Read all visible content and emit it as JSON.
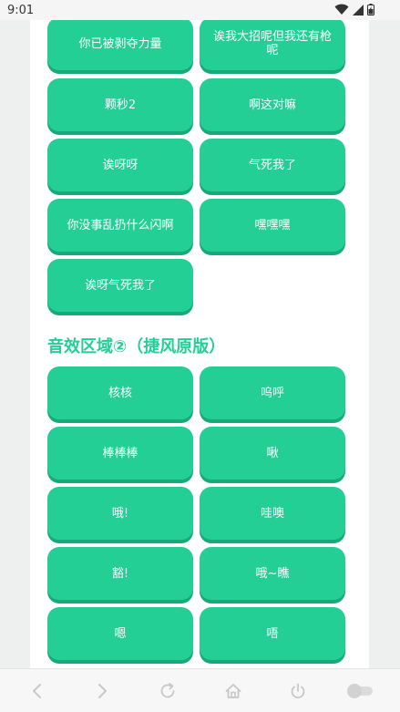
{
  "status_bar": {
    "time": "9:01"
  },
  "section1_buttons": [
    "你已被剥夺力量",
    "诶我大招呢但我还有枪呢",
    "颗秒2",
    "啊这对嘛",
    "诶呀呀",
    "气死我了",
    "你没事乱扔什么闪啊",
    "嘿嘿嘿",
    "诶呀气死我了"
  ],
  "section2": {
    "title": "音效区域②（捷风原版）",
    "buttons": [
      "核核",
      "呜呼",
      "棒棒棒",
      "啾",
      "哦!",
      "哇噢",
      "豁!",
      "哦~瞧",
      "嗯",
      "唔"
    ]
  },
  "colors": {
    "accent": "#24cf95",
    "accent_shadow": "#19a877",
    "nav_icon": "#c8c8c8"
  },
  "icons": {
    "status": [
      "wifi-icon",
      "signal-icon",
      "battery-icon"
    ],
    "nav": [
      "back-icon",
      "forward-icon",
      "refresh-icon",
      "home-icon",
      "power-icon",
      "toggle-switch"
    ]
  }
}
